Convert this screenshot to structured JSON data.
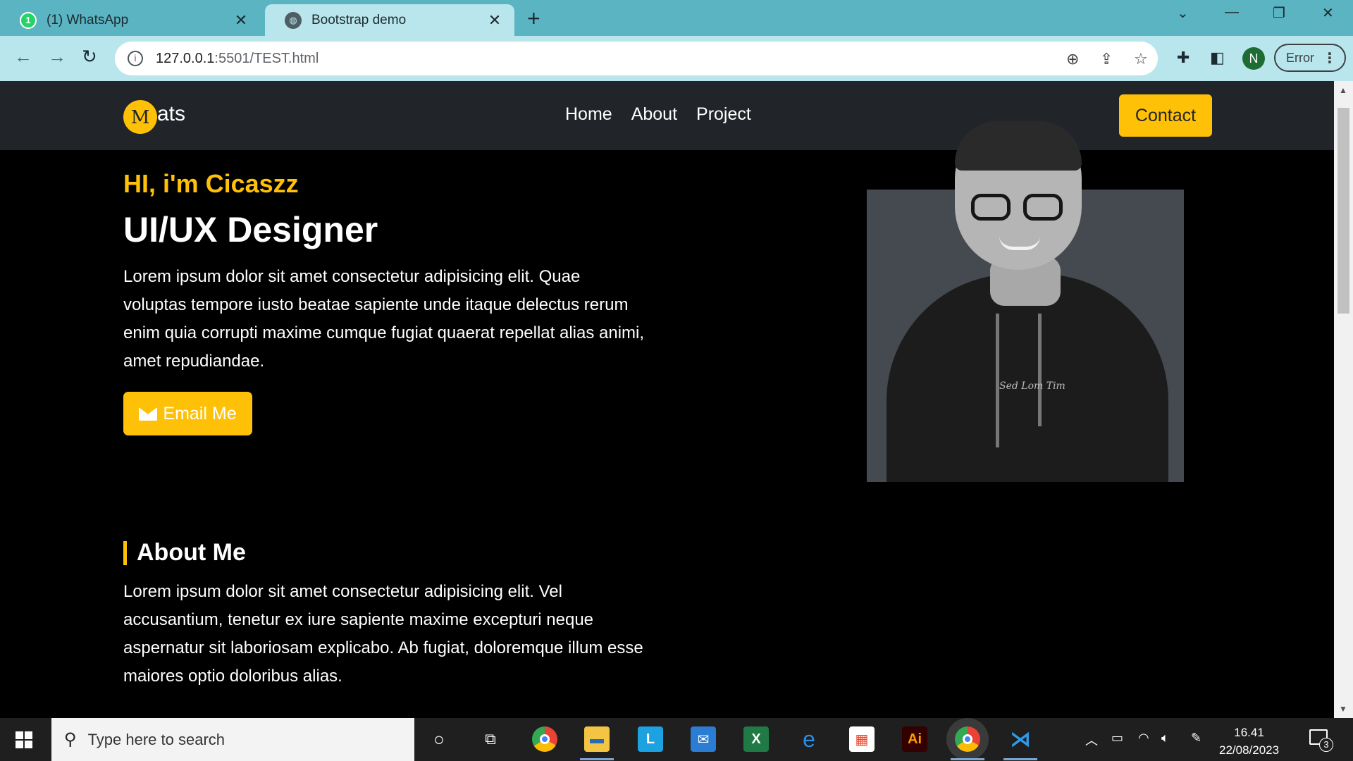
{
  "browser": {
    "tabs": [
      {
        "title": "(1) WhatsApp",
        "icon": "whatsapp-icon",
        "active": false
      },
      {
        "title": "Bootstrap demo",
        "icon": "globe-icon",
        "active": true
      }
    ],
    "new_tab": "+",
    "url_host": "127.0.0.1",
    "url_rest": ":5501/TEST.html",
    "profile_initial": "N",
    "error_label": "Error"
  },
  "site": {
    "brand_letter": "M",
    "brand_rest": "ats",
    "nav": [
      "Home",
      "About",
      "Project"
    ],
    "contact_label": "Contact",
    "hero": {
      "greeting": "HI, i'm Cicaszz",
      "role": "UI/UX Designer",
      "text": "Lorem ipsum dolor sit amet consectetur adipisicing elit. Quae voluptas tempore iusto beatae sapiente unde itaque delectus rerum enim quia corrupti maxime cumque fugiat quaerat repellat alias animi, amet repudiandae.",
      "email_label": "Email Me"
    },
    "photo_caption_text": "Sed Lom Tim",
    "about": {
      "title": "About Me",
      "text": "Lorem ipsum dolor sit amet consectetur adipisicing elit. Vel accusantium, tenetur ex iure sapiente maxime excepturi neque aspernatur sit laboriosam explicabo. Ab fugiat, doloremque illum esse maiores optio doloribus alias."
    },
    "accent_color": "#ffc107"
  },
  "taskbar": {
    "search_placeholder": "Type here to search",
    "time": "16.41",
    "date": "22/08/2023",
    "notification_count": "3",
    "apps": [
      "cortana-icon",
      "task-view-icon",
      "chrome-icon",
      "file-explorer-icon",
      "l-app-icon",
      "mail-icon",
      "excel-icon",
      "edge-icon",
      "store-icon",
      "illustrator-icon",
      "chrome-profile-icon",
      "vscode-icon"
    ]
  }
}
